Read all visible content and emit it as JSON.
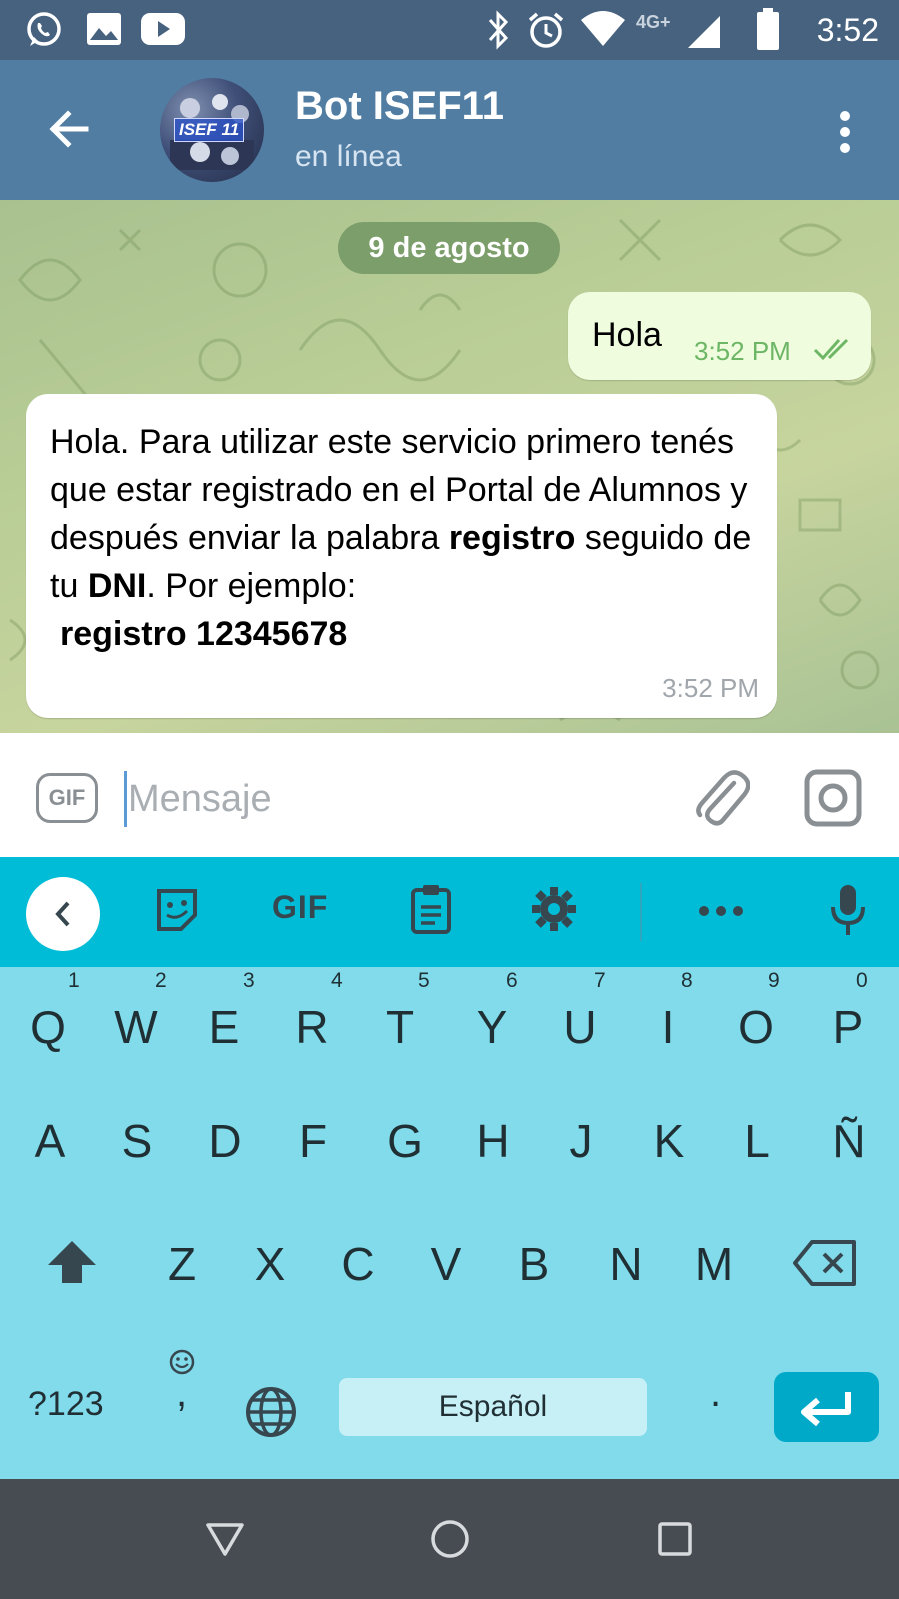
{
  "status_bar": {
    "time": "3:52",
    "network": "4G+",
    "icons": [
      "whatsapp-icon",
      "gallery-icon",
      "youtube-icon",
      "bluetooth-icon",
      "alarm-icon",
      "wifi-icon",
      "signal-icon",
      "battery-icon"
    ]
  },
  "header": {
    "title": "Bot ISEF11",
    "status": "en línea",
    "avatar_text": "ISEF 11"
  },
  "chat": {
    "date": "9 de agosto",
    "messages": [
      {
        "direction": "out",
        "text": "Hola",
        "time": "3:52 PM",
        "read": true
      },
      {
        "direction": "in",
        "text_parts": [
          "Hola. Para utilizar este servicio primero tenés que estar registrado en el Portal de Alumnos y después enviar la palabra ",
          "registro",
          " seguido de tu ",
          "DNI",
          ". Por ejemplo:",
          "registro 12345678"
        ],
        "time": "3:52 PM"
      }
    ]
  },
  "input": {
    "gif_label": "GIF",
    "placeholder": "Mensaje"
  },
  "keyboard": {
    "strip_gif": "GIF",
    "row1": [
      "Q",
      "W",
      "E",
      "R",
      "T",
      "Y",
      "U",
      "I",
      "O",
      "P"
    ],
    "row1_hints": [
      "1",
      "2",
      "3",
      "4",
      "5",
      "6",
      "7",
      "8",
      "9",
      "0"
    ],
    "row2": [
      "A",
      "S",
      "D",
      "F",
      "G",
      "H",
      "J",
      "K",
      "L",
      "Ñ"
    ],
    "row3": [
      "Z",
      "X",
      "C",
      "V",
      "B",
      "N",
      "M"
    ],
    "symbols": "?123",
    "comma": ",",
    "space": "Español",
    "period": "."
  },
  "colors": {
    "header": "#517da2",
    "status_bar": "#46627f",
    "bubble_out": "#effdde",
    "keyboard": "#81dbeb",
    "keyboard_strip": "#00bcd6"
  }
}
